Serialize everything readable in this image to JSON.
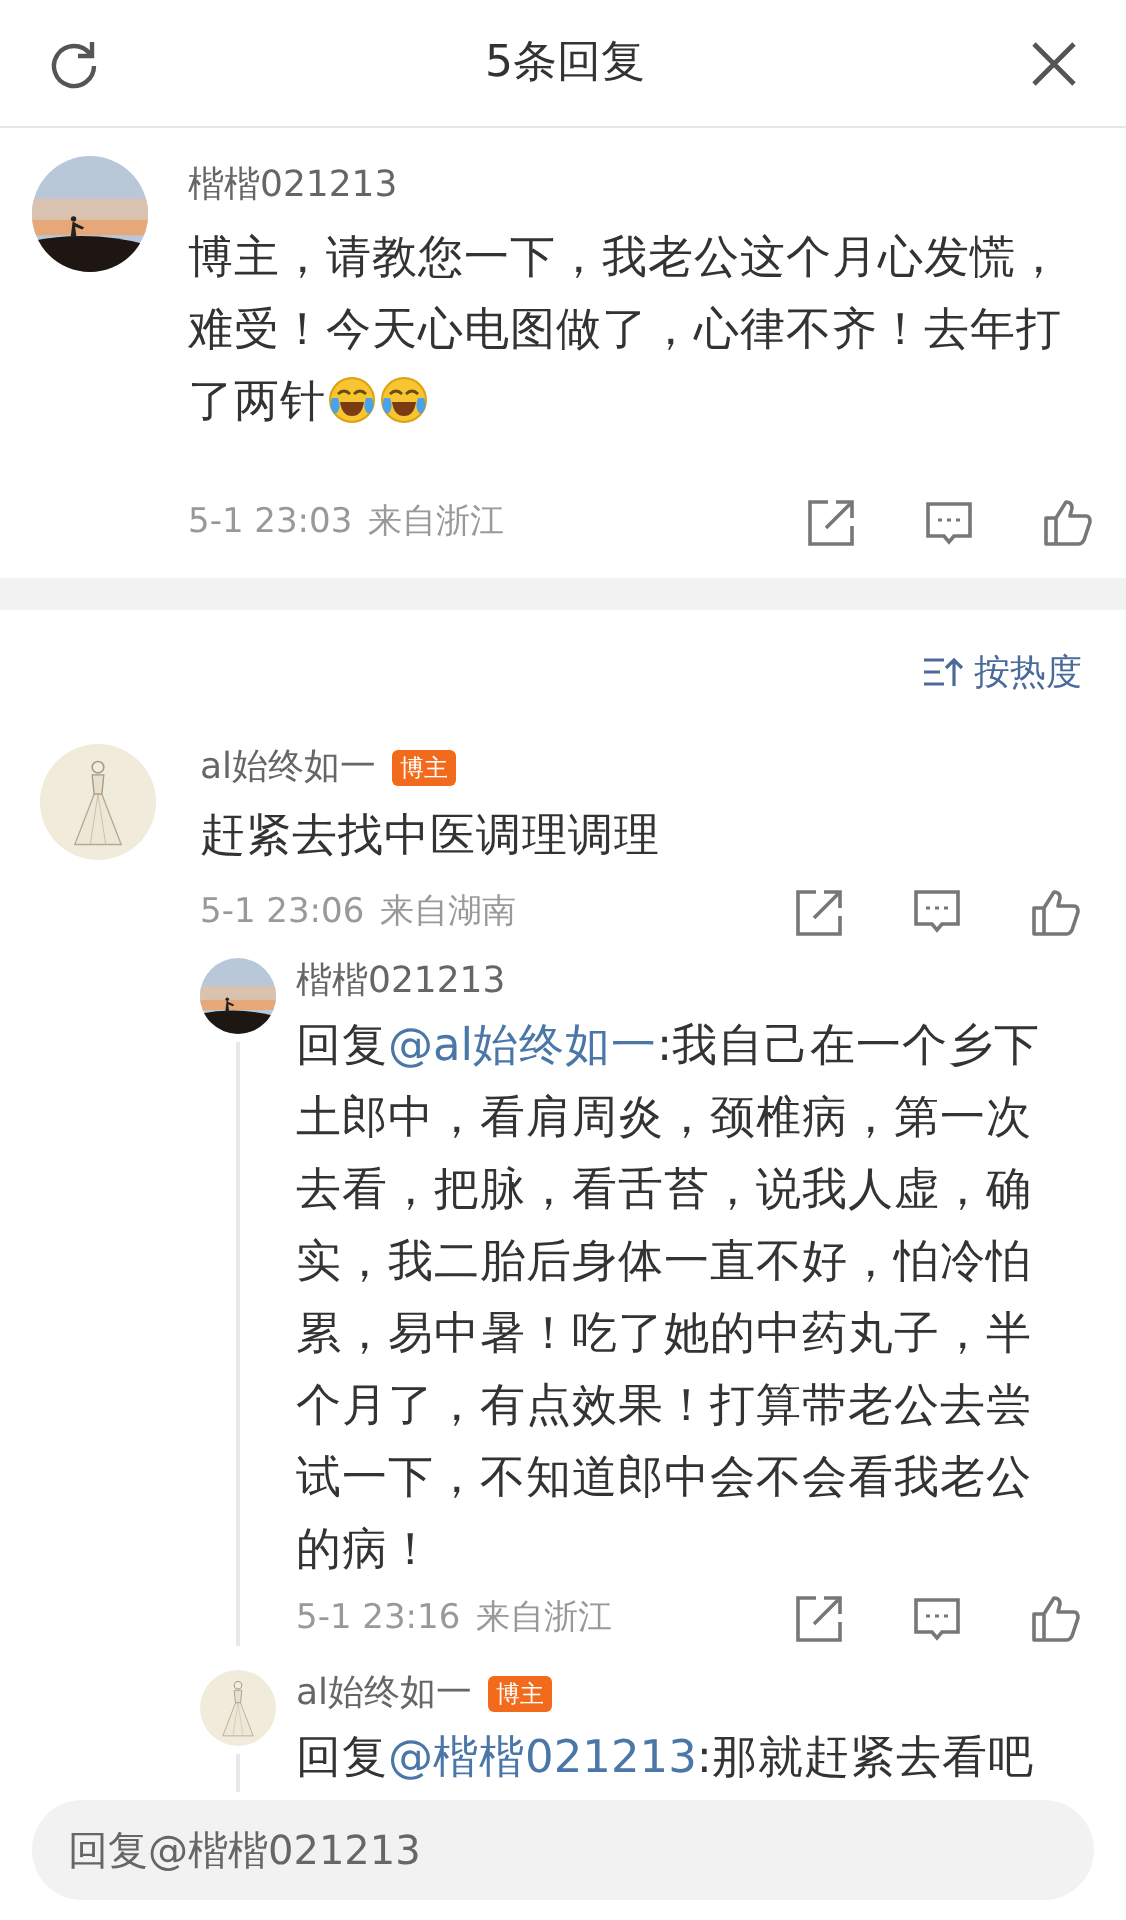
{
  "header": {
    "title": "5条回复"
  },
  "main_comment": {
    "user": "楷楷021213",
    "text": "博主，请教您一下，我老公这个月心发慌，难受！今天心电图做了，心律不齐！去年打了两针",
    "emojis": [
      {
        "kind": "laugh-cry"
      },
      {
        "kind": "laugh-cry"
      }
    ],
    "time": "5-1 23:03",
    "location": "来自浙江"
  },
  "sort": {
    "label": "按热度"
  },
  "replies": [
    {
      "user": "al始终如一",
      "badge": "博主",
      "text": "赶紧去找中医调理调理",
      "time": "5-1 23:06",
      "location": "来自湖南",
      "children": [
        {
          "user": "楷楷021213",
          "prefix": "回复",
          "mention": "@al始终如一",
          "text": ":我自己在一个乡下土郎中，看肩周炎，颈椎病，第一次去看，把脉，看舌苔，说我人虚，确实，我二胎后身体一直不好，怕冷怕累，易中暑！吃了她的中药丸子，半个月了，有点效果！打算带老公去尝试一下，不知道郎中会不会看我老公的病！",
          "time": "5-1 23:16",
          "location": "来自浙江"
        },
        {
          "user": "al始终如一",
          "badge": "博主",
          "prefix": "回复",
          "mention": "@楷楷021213",
          "text": ":那就赶紧去看吧"
        }
      ]
    }
  ],
  "reply_input": {
    "placeholder": "回复@楷楷021213"
  }
}
